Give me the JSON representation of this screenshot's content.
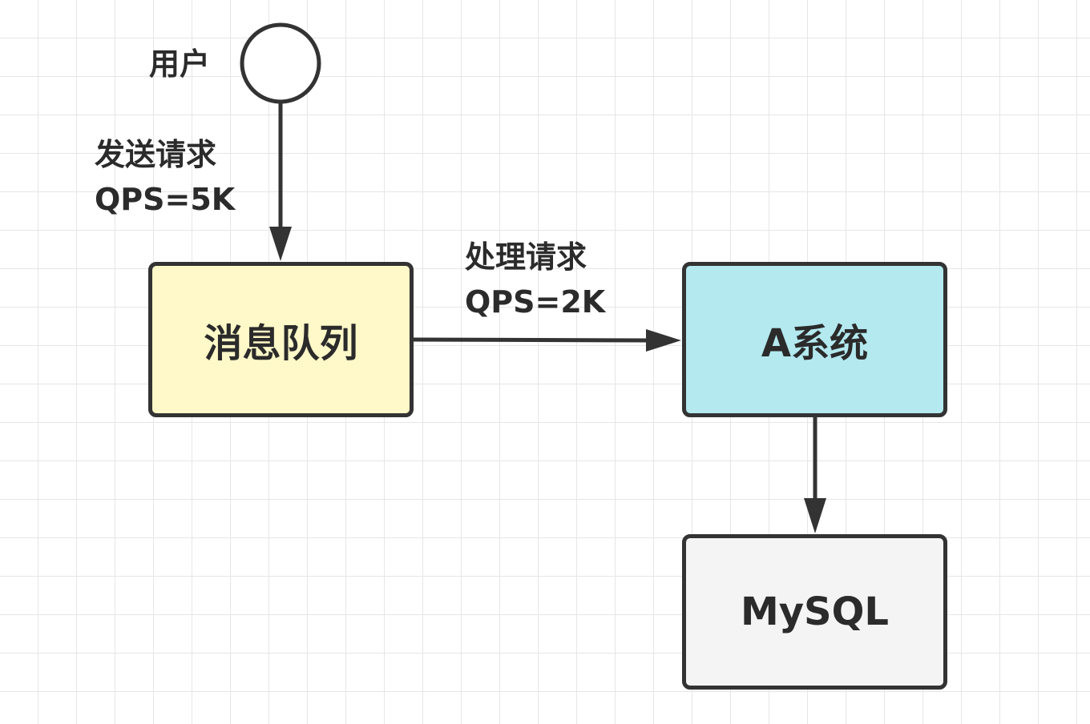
{
  "colors": {
    "stroke": "#333333",
    "queue_fill": "#fff8c8",
    "system_fill": "#b3e9ef",
    "db_fill": "#f4f4f4",
    "user_fill": "#ffffff",
    "grid": "#e6e6e6"
  },
  "user": {
    "label": "用户"
  },
  "edges": {
    "send": {
      "line1": "发送请求",
      "line2": "QPS=5K"
    },
    "process": {
      "line1": "处理请求",
      "line2": "QPS=2K"
    }
  },
  "nodes": {
    "queue": {
      "label": "消息队列"
    },
    "system_a": {
      "label": "A系统"
    },
    "mysql": {
      "label": "MySQL"
    }
  }
}
